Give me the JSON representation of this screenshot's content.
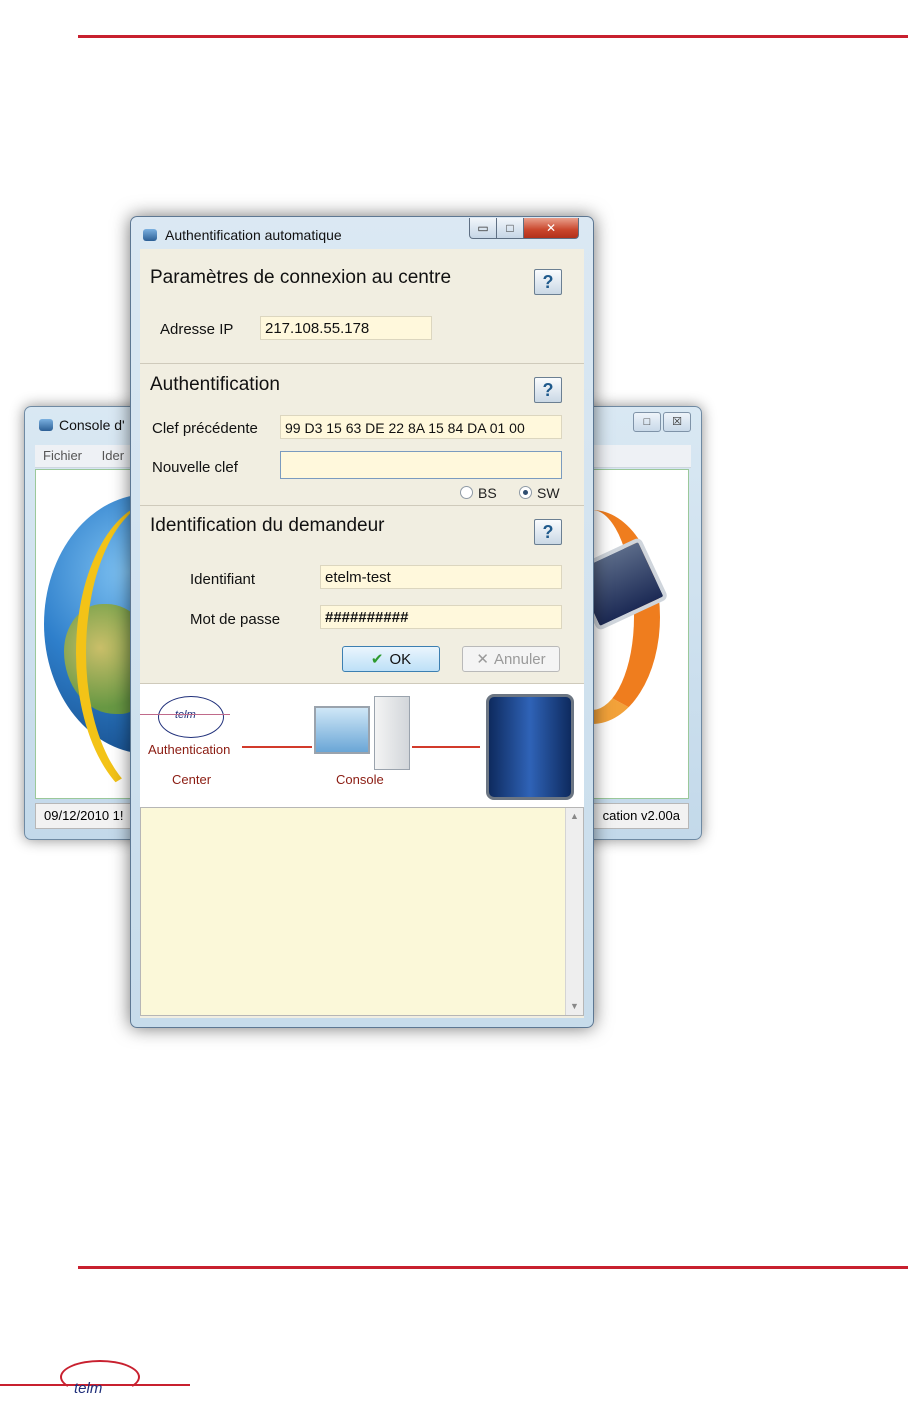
{
  "colors": {
    "accent": "#c8202f",
    "field_bg": "#fff8dc",
    "log_bg": "#fbf8d9"
  },
  "background_window": {
    "title": "Console d'",
    "menu": [
      "Fichier",
      "Ider"
    ],
    "status_left": "09/12/2010 1!",
    "status_right": "cation v2.00a",
    "controls": [
      "□",
      "☒"
    ]
  },
  "dialog": {
    "title": "Authentification automatique",
    "controls": {
      "minimize": "▭",
      "maximize": "□",
      "close": "✕"
    },
    "connection": {
      "heading": "Paramètres de connexion au centre",
      "help": "?",
      "ip_label": "Adresse IP",
      "ip_value": "217.108.55.178"
    },
    "auth": {
      "heading": "Authentification",
      "help": "?",
      "prev_key_label": "Clef précédente",
      "prev_key_value": "99 D3 15 63 DE 22 8A 15 84 DA 01 00",
      "new_key_label": "Nouvelle clef",
      "new_key_value": "",
      "radio_bs": "BS",
      "radio_sw": "SW",
      "selected": "SW"
    },
    "requester": {
      "heading": "Identification du demandeur",
      "help": "?",
      "id_label": "Identifiant",
      "id_value": "etelm-test",
      "pwd_label": "Mot de passe",
      "pwd_value": "##########"
    },
    "buttons": {
      "ok": "OK",
      "cancel": "Annuler"
    },
    "diagram": {
      "logo_text": "telm",
      "center_label_1": "Authentication",
      "center_label_2": "Center",
      "console_label": "Console"
    }
  },
  "footer_logo": "telm"
}
